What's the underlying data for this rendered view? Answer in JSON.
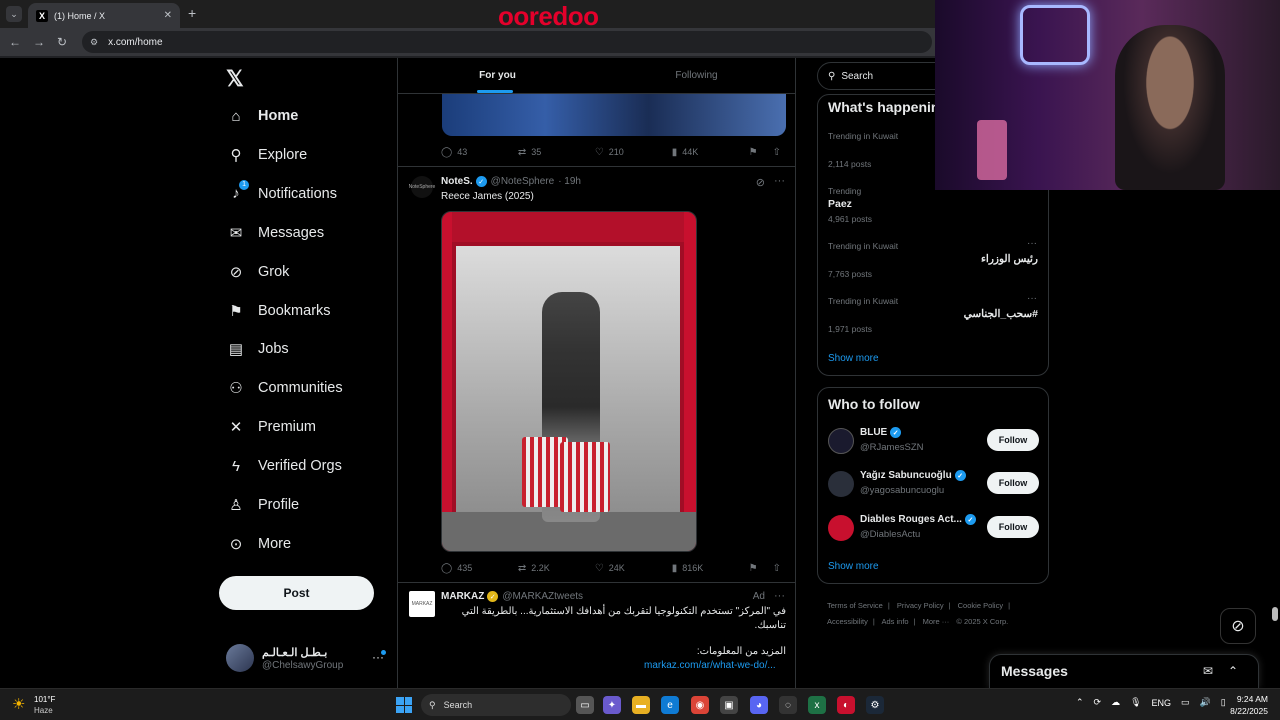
{
  "browser": {
    "tab_title": "(1) Home / X",
    "tab_favicon": "X",
    "url": "x.com/home",
    "brand_overlay": "ooredoo"
  },
  "left_nav": {
    "items": [
      {
        "label": "Home",
        "icon": "home-icon"
      },
      {
        "label": "Explore",
        "icon": "search-icon"
      },
      {
        "label": "Notifications",
        "icon": "bell-icon",
        "badge": "1"
      },
      {
        "label": "Messages",
        "icon": "mail-icon"
      },
      {
        "label": "Grok",
        "icon": "grok-icon"
      },
      {
        "label": "Bookmarks",
        "icon": "bookmark-icon"
      },
      {
        "label": "Jobs",
        "icon": "briefcase-icon"
      },
      {
        "label": "Communities",
        "icon": "people-icon"
      },
      {
        "label": "Premium",
        "icon": "x-logo-icon"
      },
      {
        "label": "Verified Orgs",
        "icon": "lightning-icon"
      },
      {
        "label": "Profile",
        "icon": "person-icon"
      },
      {
        "label": "More",
        "icon": "more-circle-icon"
      }
    ],
    "post_button": "Post",
    "account": {
      "name": "بـطـل الـعـالـم",
      "handle": "@ChelsawyGroup"
    }
  },
  "timeline": {
    "tabs": [
      "For you",
      "Following"
    ],
    "active_tab": "For you",
    "tweet1_actions": {
      "replies": "43",
      "reposts": "35",
      "likes": "210",
      "views": "44K"
    },
    "tweet2": {
      "name": "NoteS.",
      "handle": "@NoteSphere",
      "time": "· 19h",
      "avatar_text": "NoteSphere",
      "text": "Reece James (2025)",
      "actions": {
        "replies": "435",
        "reposts": "2.2K",
        "likes": "24K",
        "views": "816K"
      }
    },
    "tweet3": {
      "name": "MARKAZ",
      "handle": "@MARKAZtweets",
      "ad_label": "Ad",
      "avatar_text": "MARKAZ",
      "text_line1": "في \"المركز\" تستخدم التكنولوجيا لتقربك من أهدافك الاستثمارية... بالطريقة التي",
      "text_line2": "تناسبك.",
      "text_line3": "المزيد من المعلومات:",
      "link": "markaz.com/ar/what-we-do/..."
    }
  },
  "right": {
    "search_placeholder": "Search",
    "trends_title": "What's happening",
    "trends": [
      {
        "meta": "Trending in Kuwait",
        "name": "",
        "posts": "2,114 posts"
      },
      {
        "meta": "Trending",
        "name": "Paez",
        "posts": "4,961 posts"
      },
      {
        "meta": "Trending in Kuwait",
        "name": "رئيس الوزراء",
        "posts": "7,763 posts"
      },
      {
        "meta": "Trending in Kuwait",
        "name": "#سحب_الجناسي",
        "posts": "1,971 posts"
      }
    ],
    "show_more": "Show more",
    "wtf_title": "Who to follow",
    "who_to_follow": [
      {
        "name": "BLUE",
        "handle": "@RJamesSZN",
        "follow": "Follow",
        "color": "#1a1a2e"
      },
      {
        "name": "Yağız Sabuncuoğlu",
        "handle": "@yagosabuncuoglu",
        "follow": "Follow",
        "color": "#2a2f3a"
      },
      {
        "name": "Diables Rouges Act...",
        "handle": "@DiablesActu",
        "follow": "Follow",
        "color": "#c8102e"
      }
    ],
    "wtf_show_more": "Show more",
    "footer": [
      "Terms of Service",
      "|",
      "Privacy Policy",
      "|",
      "Cookie Policy",
      "|",
      "Accessibility",
      "|",
      "Ads info",
      "|",
      "More ···",
      "© 2025 X Corp."
    ]
  },
  "messages_drawer": {
    "title": "Messages"
  },
  "taskbar": {
    "temp": "101°F",
    "weather": "Haze",
    "search": "Search",
    "lang": "ENG",
    "time": "9:24 AM",
    "date": "8/22/2025"
  },
  "colors": {
    "accent": "#1d9bf0",
    "bg": "#000000",
    "border": "#2f3336"
  }
}
